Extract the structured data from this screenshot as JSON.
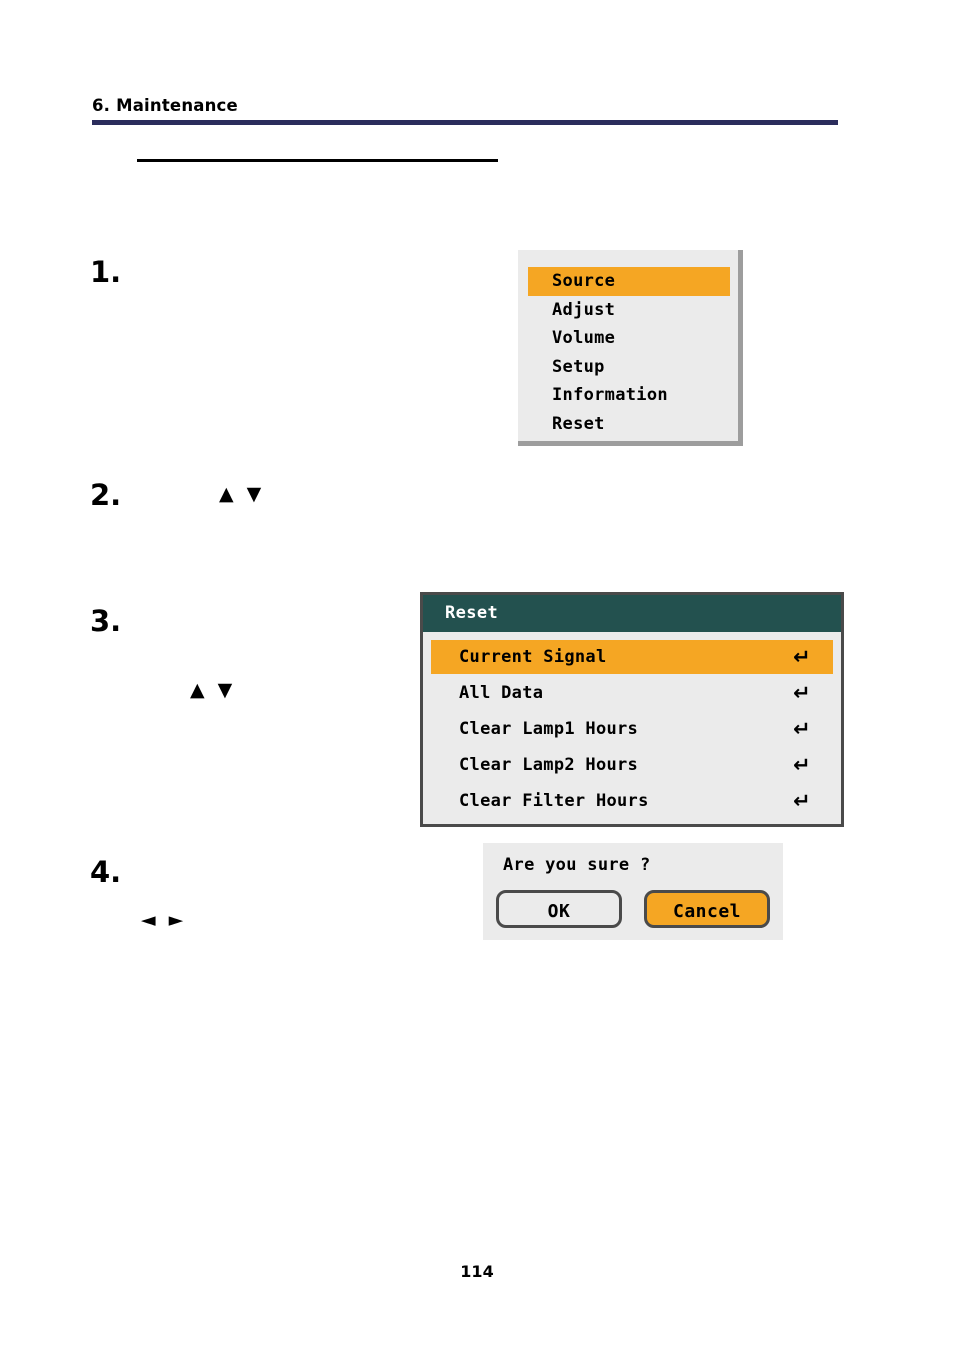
{
  "header": {
    "chapter_title": "6. Maintenance",
    "rule_color": "#2b2d5c"
  },
  "steps": [
    {
      "number": "1."
    },
    {
      "number": "2."
    },
    {
      "number": "3."
    },
    {
      "number": "4."
    }
  ],
  "arrows": {
    "up": "▲",
    "down": "▼",
    "left": "◄",
    "right": "►"
  },
  "main_menu": {
    "selected": "Source",
    "highlight_color": "#f5a623",
    "background_color": "#ebebeb",
    "items": [
      {
        "label": "Source"
      },
      {
        "label": "Adjust"
      },
      {
        "label": "Volume"
      },
      {
        "label": "Setup"
      },
      {
        "label": "Information"
      },
      {
        "label": "Reset"
      }
    ]
  },
  "reset_menu": {
    "title": "Reset",
    "title_bar_color": "#23514f",
    "highlight_color": "#f5a623",
    "background_color": "#ebebeb",
    "enter_icon": "↵",
    "items": [
      {
        "label": "Current Signal",
        "enter": "↵"
      },
      {
        "label": "All Data",
        "enter": "↵"
      },
      {
        "label": "Clear Lamp1 Hours",
        "enter": "↵"
      },
      {
        "label": "Clear Lamp2 Hours",
        "enter": "↵"
      },
      {
        "label": "Clear Filter Hours",
        "enter": "↵"
      }
    ]
  },
  "confirm_dialog": {
    "question": "Are you sure ?",
    "ok_label": "OK",
    "cancel_label": "Cancel",
    "selected": "Cancel",
    "highlight_color": "#f5a623",
    "background_color": "#ebebeb"
  },
  "footer": {
    "page_number": "114"
  }
}
